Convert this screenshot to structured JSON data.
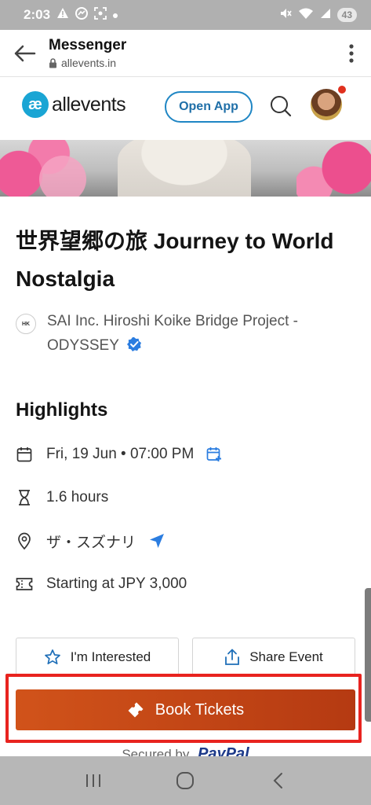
{
  "status_bar": {
    "time": "2:03",
    "battery": "43"
  },
  "tab": {
    "title": "Messenger",
    "url": "allevents.in"
  },
  "site_nav": {
    "logo_mark": "æ",
    "logo_text": "allevents",
    "open_app": "Open App"
  },
  "event": {
    "title": "世界望郷の旅 Journey to World Nostalgia",
    "organizer": "SAI Inc. Hiroshi Koike Bridge Project - ODYSSEY"
  },
  "highlights": {
    "heading": "Highlights",
    "date": "Fri, 19 Jun • 07:00 PM",
    "duration": "1.6 hours",
    "venue": "ザ・スズナリ",
    "price": "Starting at JPY 3,000"
  },
  "actions": {
    "interested": "I'm Interested",
    "share": "Share Event",
    "book": "Book Tickets",
    "secured_by": "Secured by",
    "paypal": "PayPal"
  },
  "colors": {
    "accent": "#1f86c4",
    "book_button": "#c2461a",
    "highlight_frame": "#e8231f"
  }
}
